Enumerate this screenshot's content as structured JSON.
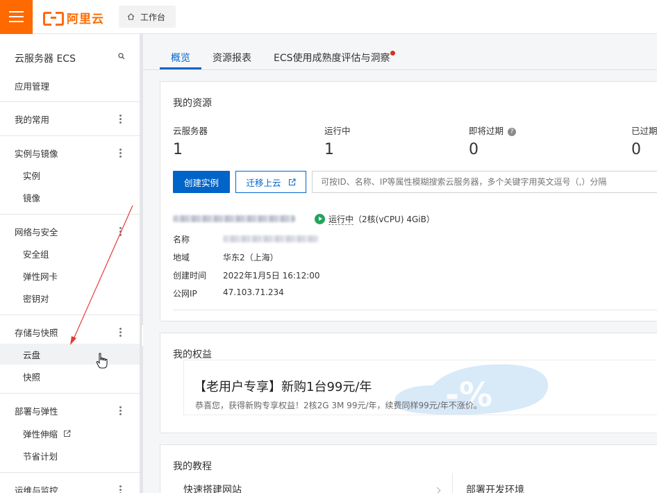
{
  "topbar": {
    "logo_text": "阿里云",
    "workbench_label": "工作台"
  },
  "sidebar": {
    "title": "云服务器 ECS",
    "app_management": "应用管理",
    "groups": {
      "favorites": "我的常用",
      "instances_images": "实例与镜像",
      "network_security": "网络与安全",
      "storage_snapshots": "存储与快照",
      "deploy_elastic": "部署与弹性",
      "ops_monitor": "运维与监控"
    },
    "items": {
      "instances": "实例",
      "images": "镜像",
      "security_groups": "安全组",
      "eni": "弹性网卡",
      "keypairs": "密钥对",
      "cloud_disk": "云盘",
      "snapshots": "快照",
      "auto_scaling": "弹性伸缩",
      "savings_plan": "节省计划"
    }
  },
  "tabs": [
    "概览",
    "资源报表",
    "ECS使用成熟度评估与洞察"
  ],
  "resources": {
    "title": "我的资源",
    "stats": [
      {
        "label": "云服务器",
        "value": "1"
      },
      {
        "label": "运行中",
        "value": "1"
      },
      {
        "label": "即将过期",
        "value": "0"
      },
      {
        "label": "已过期",
        "value": "0"
      }
    ],
    "create_button": "创建实例",
    "migrate_button": "迁移上云",
    "search_placeholder": "可按ID、名称、IP等属性模糊搜索云服务器，多个关键字用英文逗号（,）分隔",
    "instance": {
      "status": "运行中",
      "spec": "（2核(vCPU) 4GiB）",
      "rows": [
        {
          "key": "名称",
          "value": ""
        },
        {
          "key": "地域",
          "value": "华东2（上海）"
        },
        {
          "key": "创建时间",
          "value": "2022年1月5日 16:12:00"
        },
        {
          "key": "公网IP",
          "value": "47.103.71.234"
        }
      ]
    }
  },
  "benefits": {
    "title": "我的权益",
    "promo_title": "【老用户专享】新购1台99元/年",
    "promo_sub": "恭喜您，获得新购专享权益！2核2G 3M 99元/年，续费同样99元/年不涨价。",
    "deco_text": "-%"
  },
  "tutorials": {
    "title": "我的教程",
    "items": [
      "快速搭建网站",
      "部署开发环境"
    ]
  },
  "colors": {
    "brand_orange": "#ff6a00",
    "primary_blue": "#0064c8",
    "running_green": "#23a45b",
    "alert_red": "#d93026"
  }
}
